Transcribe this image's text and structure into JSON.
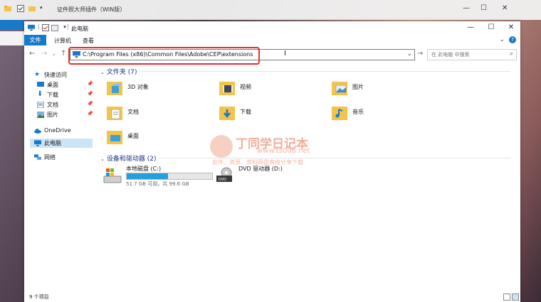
{
  "back_window": {
    "title": "证件照大师插件（WIN版）"
  },
  "window": {
    "title": "此电脑",
    "controls": {
      "minimize": "—",
      "maximize": "☐",
      "close": "✕"
    }
  },
  "ribbon": {
    "tabs": [
      "文件",
      "计算机",
      "查看"
    ],
    "help": "?"
  },
  "address_bar": {
    "path": "C:\\Program Files (x86)\\Common Files\\Adobe\\CEP\\extensions",
    "search_placeholder": "在 此电脑 中搜索"
  },
  "sidebar": {
    "quick_access": "快速访问",
    "quick_items": [
      "桌面",
      "下载",
      "文档",
      "图片"
    ],
    "onedrive": "OneDrive",
    "this_pc": "此电脑",
    "network": "网络"
  },
  "folders_group": {
    "header": "文件夹 (7)",
    "items": [
      "3D 对象",
      "视频",
      "图片",
      "文档",
      "下载",
      "音乐",
      "桌面"
    ]
  },
  "devices_group": {
    "header": "设备和驱动器 (2)",
    "drives": [
      {
        "name": "本地磁盘 (C:)",
        "size": "51.7 GB 可用，共 99.6 GB",
        "used_fraction": 0.48
      },
      {
        "name": "DVD 驱动器 (D:)"
      }
    ]
  },
  "status": {
    "item_count": "9 个项目"
  },
  "watermark": {
    "line1": "丁同学日记本",
    "line2": "www.ts006.net",
    "line3": "软件、资源、资料网盘直接分享下载"
  },
  "colors": {
    "accent": "#1979ca",
    "folder": "#f4c34a",
    "highlight": "#e82c2c",
    "drive_fill": "#26a0da"
  }
}
